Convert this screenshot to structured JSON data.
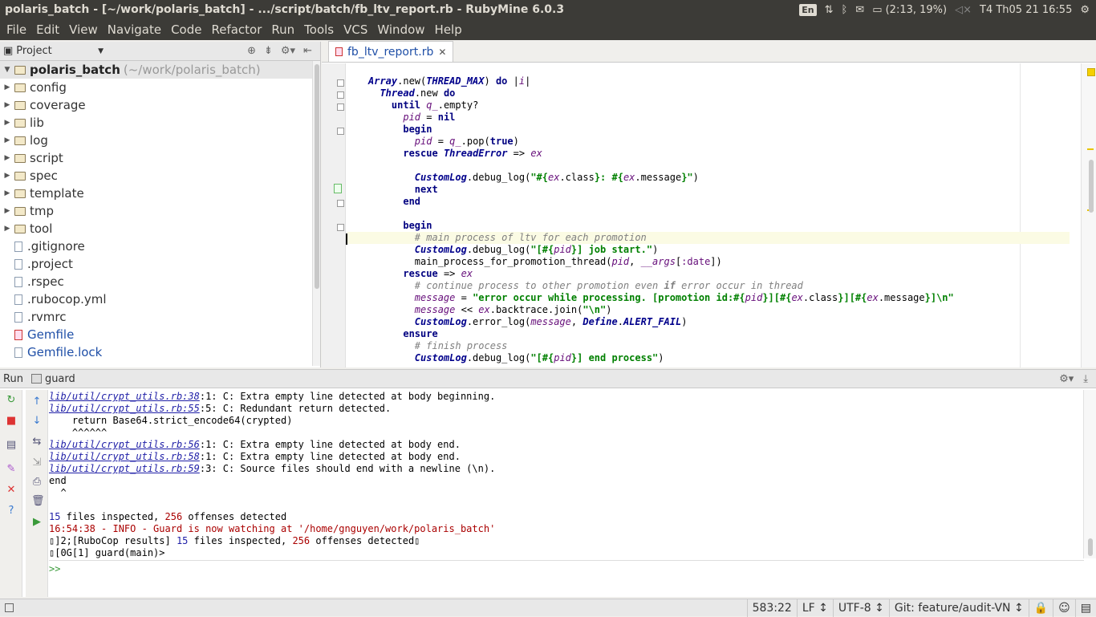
{
  "window_title": "polaris_batch - [~/work/polaris_batch] - .../script/batch/fb_ltv_report.rb - RubyMine 6.0.3",
  "indicators": {
    "lang": "En",
    "battery": "(2:13, 19%)",
    "datetime": "T4 Th05 21  16:55"
  },
  "menu": [
    "File",
    "Edit",
    "View",
    "Navigate",
    "Code",
    "Refactor",
    "Run",
    "Tools",
    "VCS",
    "Window",
    "Help"
  ],
  "project_panel": {
    "label": "Project",
    "root_name": "polaris_batch",
    "root_path": "(~/work/polaris_batch)",
    "folders": [
      "config",
      "coverage",
      "lib",
      "log",
      "script",
      "spec",
      "template",
      "tmp",
      "tool"
    ],
    "files": [
      ".gitignore",
      ".project",
      ".rspec",
      ".rubocop.yml",
      ".rvmrc",
      "Gemfile",
      "Gemfile.lock"
    ]
  },
  "editor": {
    "tab": "fb_ltv_report.rb",
    "cursor_line_index": 13
  },
  "run_panel": {
    "label": "Run",
    "config": "guard",
    "input_prompt": ">>"
  },
  "status": {
    "position": "583:22",
    "line_sep": "LF ↕",
    "encoding": "UTF-8 ↕",
    "branch": "Git: feature/audit-VN ↕"
  }
}
